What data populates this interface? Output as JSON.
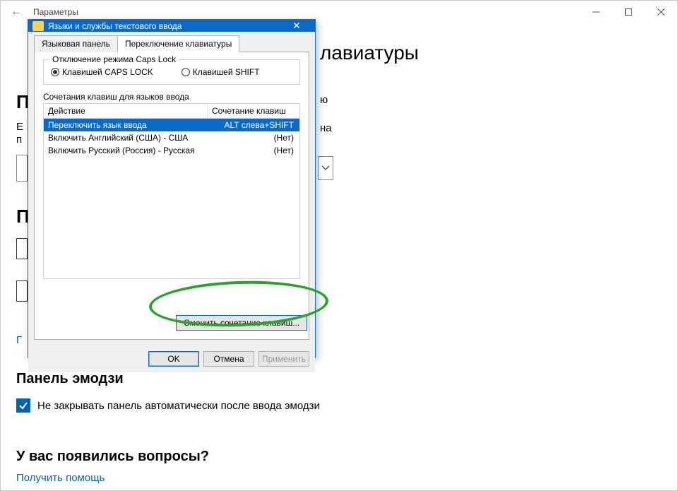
{
  "window": {
    "title": "Параметры",
    "back_glyph": "←"
  },
  "background": {
    "heading_fragment": "лавиатуры",
    "text_fragment_1": "ю",
    "text_fragment_2": "на",
    "link_stub": "Г",
    "stub_p1": "П",
    "stub_e": "Е",
    "stub_p2": "п",
    "stub_p3": "П"
  },
  "emoji": {
    "heading": "Панель эмодзи",
    "checkbox_label": "Не закрывать панель автоматически после ввода эмодзи"
  },
  "questions": {
    "heading": "У вас появились вопросы?",
    "help_link": "Получить помощь"
  },
  "dialog": {
    "title": "Языки и службы текстового ввода",
    "tabs": {
      "tab1": "Языковая панель",
      "tab2": "Переключение клавиатуры"
    },
    "caps_group": {
      "legend": "Отключение режима Caps Lock",
      "opt1": "Клавишей CAPS LOCK",
      "opt2": "Клавишей SHIFT"
    },
    "list": {
      "label": "Сочетания клавиш для языков ввода",
      "col_action": "Действие",
      "col_shortcut": "Сочетание клавиш",
      "rows": [
        {
          "action": "Переключить язык ввода",
          "shortcut": "ALT слева+SHIFT",
          "selected": true
        },
        {
          "action": "Включить Английский (США) - США",
          "shortcut": "(Нет)",
          "selected": false
        },
        {
          "action": "Включить Русский (Россия) - Русская",
          "shortcut": "(Нет)",
          "selected": false
        }
      ]
    },
    "change_button": "Сменить сочетание клавиш...",
    "buttons": {
      "ok": "OK",
      "cancel": "Отмена",
      "apply": "Применить"
    }
  }
}
